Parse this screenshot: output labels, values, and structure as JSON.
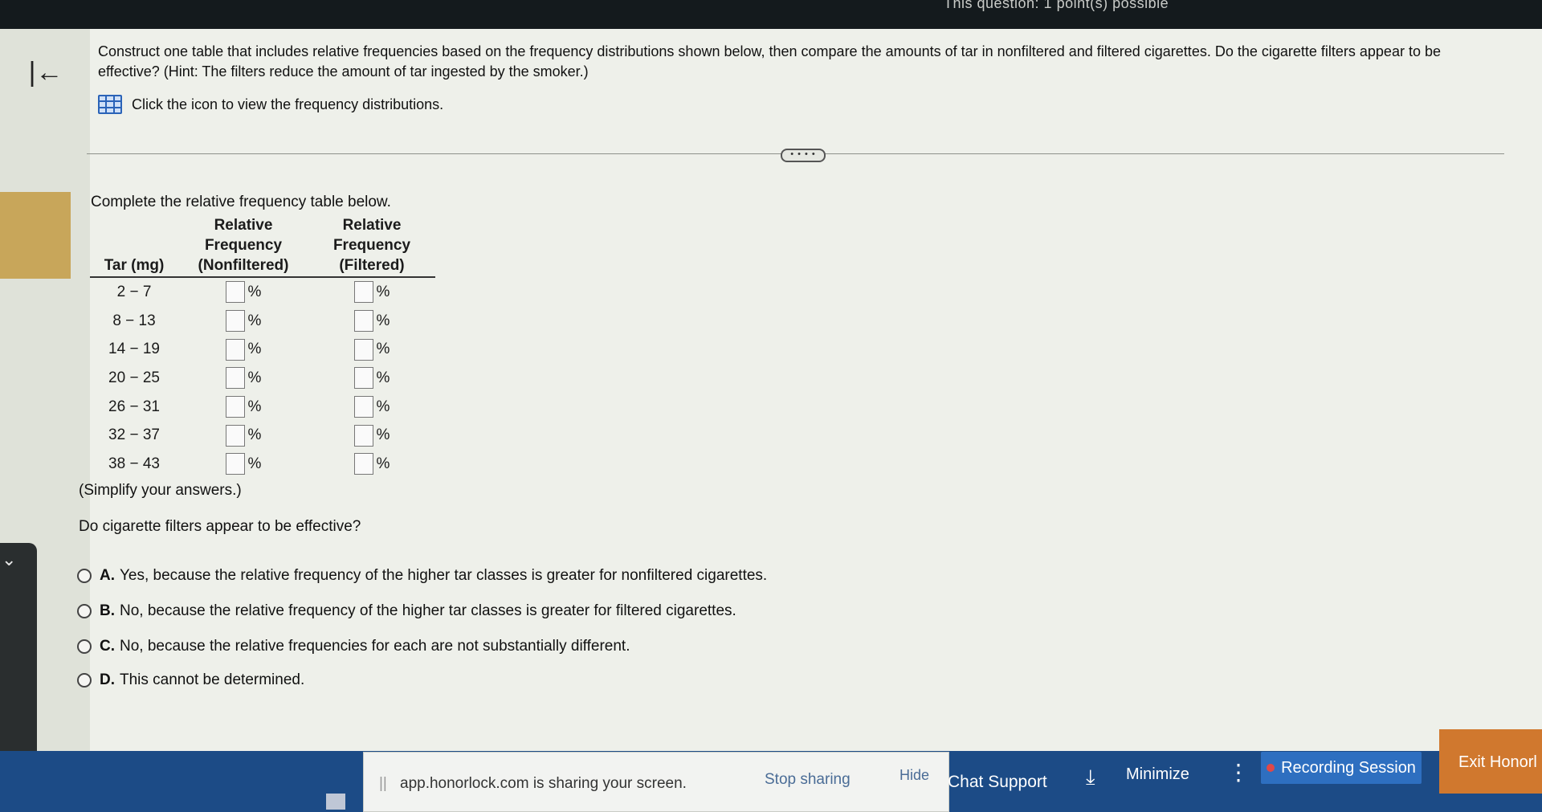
{
  "header": {
    "points_text": "This question: 1 point(s) possible"
  },
  "question": {
    "text": "Construct one table that includes relative frequencies based on the frequency distributions shown below, then compare the amounts of tar in nonfiltered and filtered cigarettes. Do the cigarette filters appear to be effective? (Hint: The filters reduce the amount of tar ingested by the smoker.)",
    "view_link": "Click the icon to view the frequency distributions."
  },
  "more_label": "• • • •",
  "table": {
    "instruction": "Complete the relative frequency table below.",
    "headers": {
      "tar": "Tar (mg)",
      "nonfiltered": "Relative Frequency (Nonfiltered)",
      "filtered": "Relative Frequency (Filtered)"
    },
    "rows": [
      {
        "tar": "2 − 7"
      },
      {
        "tar": "8 − 13"
      },
      {
        "tar": "14 − 19"
      },
      {
        "tar": "20 − 25"
      },
      {
        "tar": "26 − 31"
      },
      {
        "tar": "32 − 37"
      },
      {
        "tar": "38 − 43"
      }
    ],
    "percent_sign": "%",
    "simplify_note": "(Simplify your answers.)"
  },
  "effectiveness": {
    "prompt": "Do cigarette filters appear to be effective?",
    "options": [
      {
        "letter": "A.",
        "text": "Yes, because the relative frequency of the higher tar classes is greater for nonfiltered cigarettes."
      },
      {
        "letter": "B.",
        "text": "No, because the relative frequency of the higher tar classes is greater for filtered cigarettes."
      },
      {
        "letter": "C.",
        "text": "No, because the relative frequencies for each are not substantially different."
      },
      {
        "letter": "D.",
        "text": "This cannot be determined."
      }
    ]
  },
  "share_bar": {
    "sharing_text": "app.honorlock.com is sharing your screen.",
    "stop_sharing": "Stop sharing",
    "hide": "Hide",
    "chat_support": "Chat Support",
    "minimize": "Minimize",
    "recording": "Recording Session",
    "exit": "Exit Honorl"
  }
}
